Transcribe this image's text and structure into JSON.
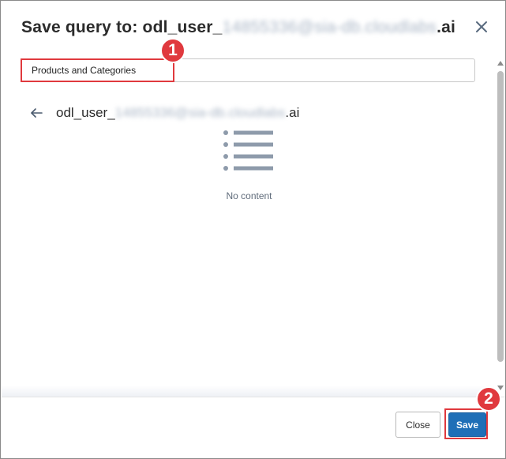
{
  "dialog": {
    "title_prefix": "Save query to: odl_user_",
    "title_blurred": "14855336@sia-db.cloudlabs",
    "title_suffix": ".ai",
    "close_icon": "close-icon"
  },
  "form": {
    "name_value": "Products and Categories"
  },
  "browser": {
    "folder_prefix": "odl_user_",
    "folder_blurred": "14855336@sia-db.cloudlabs",
    "folder_suffix": ".ai",
    "back_icon": "arrow-left-icon",
    "empty_icon": "list-icon",
    "empty_text": "No content"
  },
  "footer": {
    "close_label": "Close",
    "save_label": "Save"
  },
  "annotations": [
    {
      "label": "1"
    },
    {
      "label": "2"
    }
  ],
  "colors": {
    "marker": "#e0393e",
    "primary": "#1f6fb7",
    "muted_text": "#5f6b7a",
    "icon": "#8e9bab"
  }
}
